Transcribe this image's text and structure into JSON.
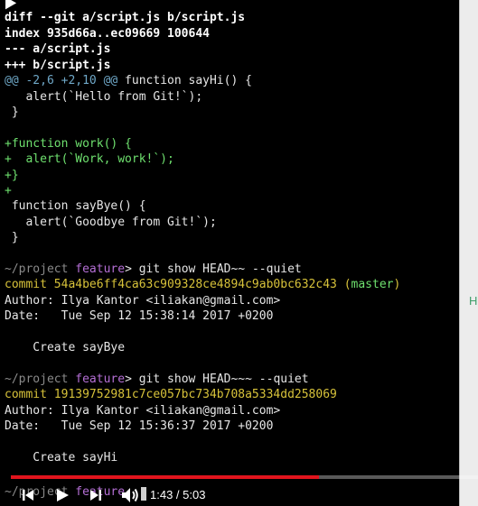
{
  "terminal": {
    "diff_header": "diff --git a/script.js b/script.js",
    "index_line": "index 935d66a..ec09669 100644",
    "minus_file": "--- a/script.js",
    "plus_file": "+++ b/script.js",
    "hunk_range": "@@ -2,6 +2,10 @@",
    "hunk_context": " function sayHi() {",
    "ctx1": "   alert(`Hello from Git!`);",
    "ctx2": " }",
    "blank1": "",
    "add1": "+function work() {",
    "add2": "+  alert(`Work, work!`);",
    "add3": "+}",
    "add4": "+",
    "ctx3": " function sayBye() {",
    "ctx4": "   alert(`Goodbye from Git!`);",
    "ctx5": " }",
    "prompt1_path": "~/project ",
    "prompt1_branch": "feature",
    "prompt1_cmd": "> git show HEAD~~ --quiet",
    "commit1_label": "commit 54a4be6ff4ca63c909328ce4894c9ab0bc632c43 ",
    "commit1_ref_open": "(",
    "commit1_ref": "master",
    "commit1_ref_close": ")",
    "author1": "Author: Ilya Kantor <iliakan@gmail.com>",
    "date1": "Date:   Tue Sep 12 15:38:14 2017 +0200",
    "msg1": "    Create sayBye",
    "prompt2_path": "~/project ",
    "prompt2_branch": "feature",
    "prompt2_cmd": "> git show HEAD~~~ --quiet",
    "commit2_label": "commit 19139752981c7ce057bc734b708a5334dd258069",
    "author2": "Author: Ilya Kantor <iliakan@gmail.com>",
    "date2": "Date:   Tue Sep 12 15:36:37 2017 +0200",
    "msg2": "    Create sayHi",
    "prompt3_path": "~/project ",
    "prompt3_branch": "feature"
  },
  "side_panel": {
    "letter": "H"
  },
  "player": {
    "time_display": "1:43 / 5:03",
    "progress_fraction": 0.66,
    "icons": [
      "skip-previous-icon",
      "play-icon",
      "skip-next-icon",
      "volume-icon"
    ]
  },
  "colors": {
    "progress": "#e1141d",
    "diff_add": "#6ee06e",
    "hunk": "#6fa8c8",
    "commit": "#d7c23a",
    "branch": "#b56fd6"
  }
}
